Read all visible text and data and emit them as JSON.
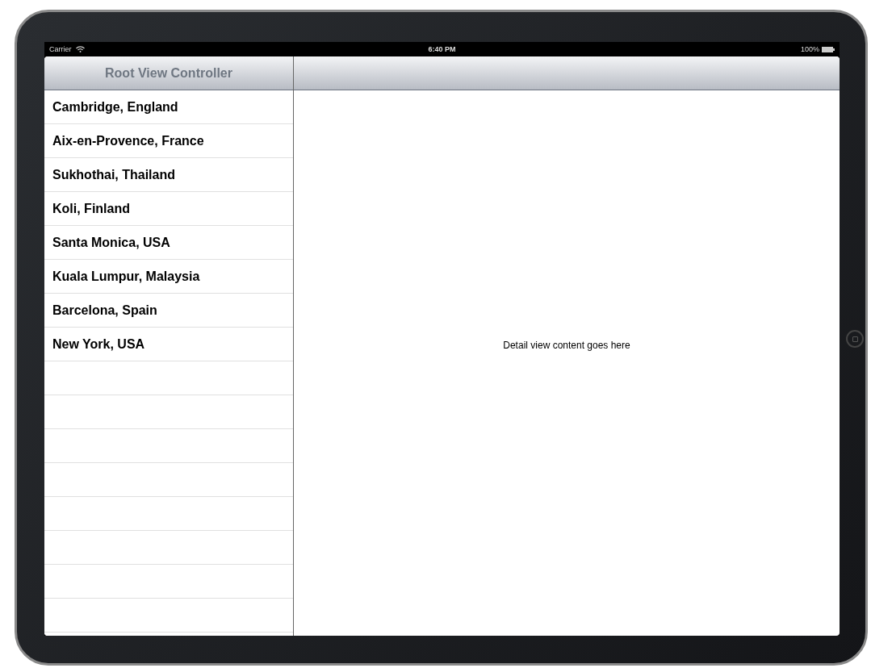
{
  "status_bar": {
    "carrier": "Carrier",
    "time": "6:40 PM",
    "battery": "100%"
  },
  "master": {
    "title": "Root View Controller",
    "items": [
      "Cambridge, England",
      "Aix-en-Provence, France",
      "Sukhothai, Thailand",
      "Koli, Finland",
      "Santa Monica, USA",
      "Kuala Lumpur, Malaysia",
      "Barcelona, Spain",
      "New York, USA"
    ]
  },
  "detail": {
    "text": "Detail view content goes here"
  }
}
